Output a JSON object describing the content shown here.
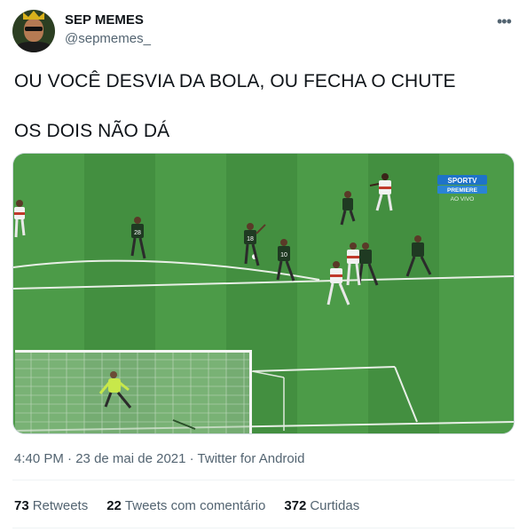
{
  "author": {
    "name": "SEP MEMES",
    "handle": "@sepmemes_"
  },
  "menu_icon": "more-icon",
  "tweet": {
    "line1": "OU VOCÊ DESVIA DA BOLA, OU FECHA O CHUTE",
    "line2": "OS DOIS NÃO DÁ"
  },
  "media": {
    "broadcaster_logo": "SPORTV",
    "broadcaster_sub": "PREMIERE",
    "live_label": "AO VIVO",
    "jersey_numbers": [
      "28",
      "18",
      "10"
    ]
  },
  "meta": {
    "time": "4:40 PM",
    "separator": " · ",
    "date": "23 de mai de 2021",
    "source": "Twitter for Android"
  },
  "stats": [
    {
      "count": "73",
      "label": "Retweets"
    },
    {
      "count": "22",
      "label": "Tweets com comentário"
    },
    {
      "count": "372",
      "label": "Curtidas"
    }
  ],
  "colors": {
    "pitch_dark": "#3d8a3c",
    "pitch_light": "#4a9a46",
    "text_secondary": "#536471"
  }
}
